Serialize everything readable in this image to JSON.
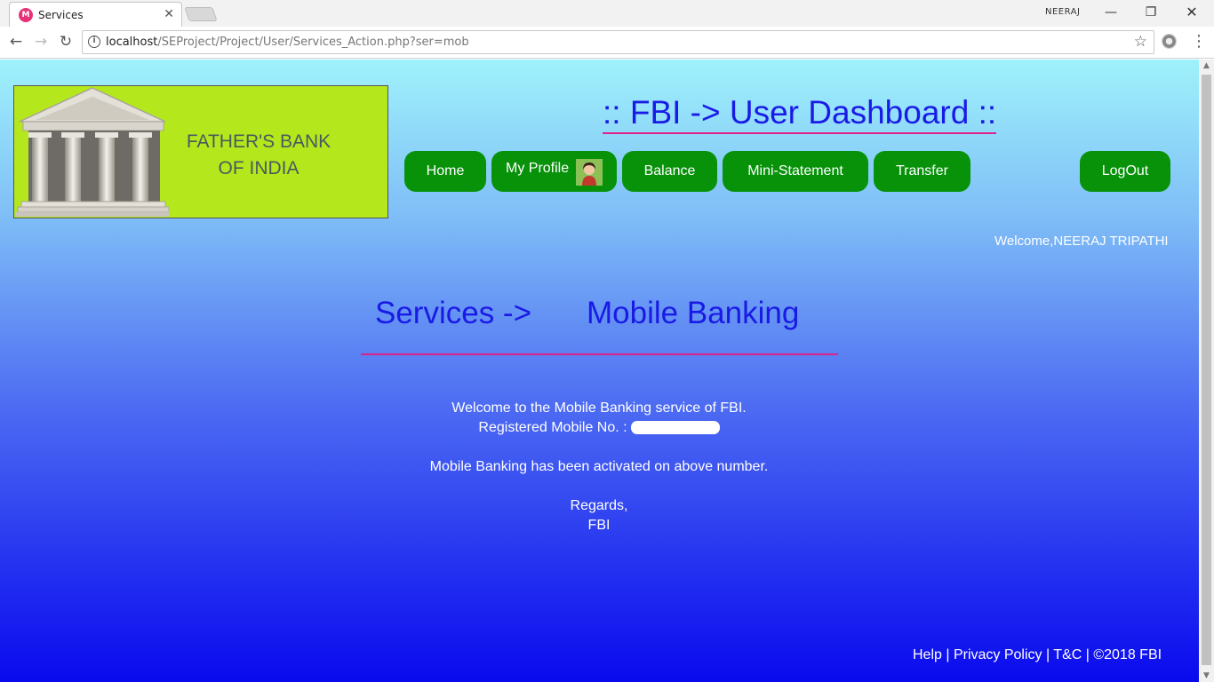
{
  "browser": {
    "tab_title": "Services",
    "tab_favicon": "M",
    "profile_name": "NEERAJ",
    "url_host": "localhost",
    "url_path": "/SEProject/Project/User/Services_Action.php?ser=mob"
  },
  "logo": {
    "line1": "FATHER'S BANK",
    "line2": "OF INDIA"
  },
  "header": {
    "title": ":: FBI -> User Dashboard ::"
  },
  "nav": {
    "home": "Home",
    "profile": "My Profile",
    "balance": "Balance",
    "mini_statement": "Mini-Statement",
    "transfer": "Transfer",
    "logout": "LogOut"
  },
  "user": {
    "welcome": "Welcome,NEERAJ TRIPATHI"
  },
  "service": {
    "title": "Services ->",
    "name": "Mobile Banking"
  },
  "message": {
    "line1": "Welcome to the Mobile Banking service of FBI.",
    "line2_label": "Registered Mobile No. :",
    "line3": "Mobile Banking has been activated on above number.",
    "line4": "Regards,",
    "line5": "FBI"
  },
  "footer": {
    "help": "Help",
    "sep1": " | ",
    "privacy": "Privacy Policy",
    "sep2": " | ",
    "tnc": "T&C",
    "sep3": " | ",
    "copyright": "©2018 FBI"
  },
  "colors": {
    "accent_blue": "#1a1ae6",
    "underline_pink": "#e0208a",
    "button_green": "#07920a",
    "logo_bg": "#b4e81c"
  }
}
